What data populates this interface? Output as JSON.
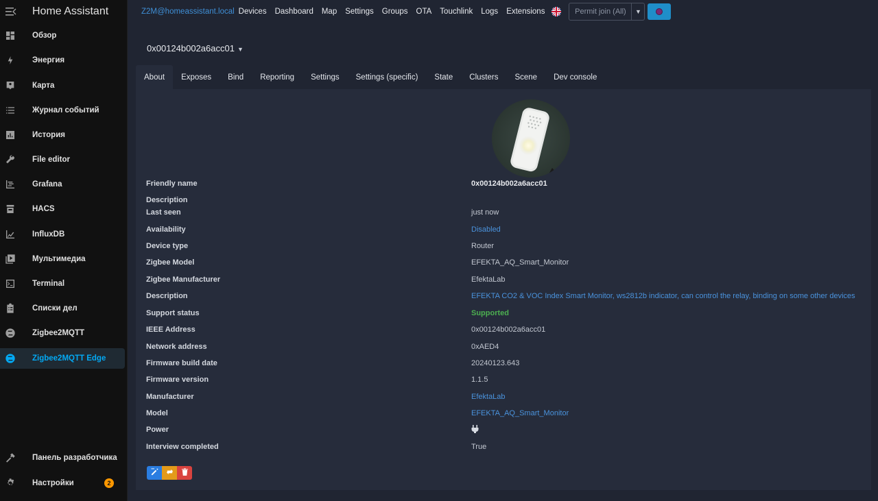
{
  "app": {
    "title": "Home Assistant"
  },
  "sidebar": {
    "items": [
      {
        "label": "Обзор",
        "icon": "dashboard-icon"
      },
      {
        "label": "Энергия",
        "icon": "lightning-icon"
      },
      {
        "label": "Карта",
        "icon": "map-person-icon"
      },
      {
        "label": "Журнал событий",
        "icon": "list-icon"
      },
      {
        "label": "История",
        "icon": "chart-box-icon"
      },
      {
        "label": "File editor",
        "icon": "wrench-icon"
      },
      {
        "label": "Grafana",
        "icon": "chart-timeline-icon"
      },
      {
        "label": "HACS",
        "icon": "store-icon"
      },
      {
        "label": "InfluxDB",
        "icon": "chart-areaspline-icon"
      },
      {
        "label": "Мультимедиа",
        "icon": "play-box-icon"
      },
      {
        "label": "Terminal",
        "icon": "console-icon"
      },
      {
        "label": "Списки дел",
        "icon": "clipboard-list-icon"
      },
      {
        "label": "Zigbee2MQTT",
        "icon": "zigbee-icon"
      },
      {
        "label": "Zigbee2MQTT Edge",
        "icon": "zigbee-icon"
      }
    ],
    "bottom": [
      {
        "label": "Панель разработчика",
        "icon": "hammer-icon"
      },
      {
        "label": "Настройки",
        "icon": "gear-icon",
        "badge": "2"
      }
    ],
    "accent": "#03a9f4"
  },
  "navbar": {
    "host": "Z2M@homeassistant.local",
    "links": [
      "Devices",
      "Dashboard",
      "Map",
      "Settings",
      "Groups",
      "OTA",
      "Touchlink",
      "Logs",
      "Extensions"
    ],
    "language_icon": "uk-flag-icon",
    "permit_join": "Permit join (All)"
  },
  "device": {
    "selected": "0x00124b002a6acc01",
    "tabs": [
      "About",
      "Exposes",
      "Bind",
      "Reporting",
      "Settings",
      "Settings (specific)",
      "State",
      "Clusters",
      "Scene",
      "Dev console"
    ],
    "active_tab": "About",
    "fields": [
      {
        "key": "Friendly name",
        "value": "0x00124b002a6acc01"
      },
      {
        "key": "Description",
        "value": ""
      },
      {
        "key": "Last seen",
        "value": "just now"
      },
      {
        "key": "Availability",
        "value": "Disabled"
      },
      {
        "key": "Device type",
        "value": "Router"
      },
      {
        "key": "Zigbee Model",
        "value": "EFEKTA_AQ_Smart_Monitor"
      },
      {
        "key": "Zigbee Manufacturer",
        "value": "EfektaLab"
      },
      {
        "key": "Description",
        "value": "EFEKTA CO2 & VOC Index Smart Monitor, ws2812b indicator, can control the relay, binding on some other devices"
      },
      {
        "key": "Support status",
        "value": "Supported"
      },
      {
        "key": "IEEE Address",
        "value": "0x00124b002a6acc01"
      },
      {
        "key": "Network address",
        "value": "0xAED4"
      },
      {
        "key": "Firmware build date",
        "value": "20240123.643"
      },
      {
        "key": "Firmware version",
        "value": "1.1.5"
      },
      {
        "key": "Manufacturer",
        "value": "EfektaLab"
      },
      {
        "key": "Model",
        "value": "EFEKTA_AQ_Smart_Monitor"
      },
      {
        "key": "Power",
        "value": "",
        "icon": "plug-icon"
      },
      {
        "key": "Interview completed",
        "value": "True"
      }
    ],
    "actions": [
      {
        "name": "edit-button",
        "icon": "pencil-icon"
      },
      {
        "name": "reconfigure-button",
        "icon": "swap-icon"
      },
      {
        "name": "remove-button",
        "icon": "trash-icon"
      }
    ]
  }
}
